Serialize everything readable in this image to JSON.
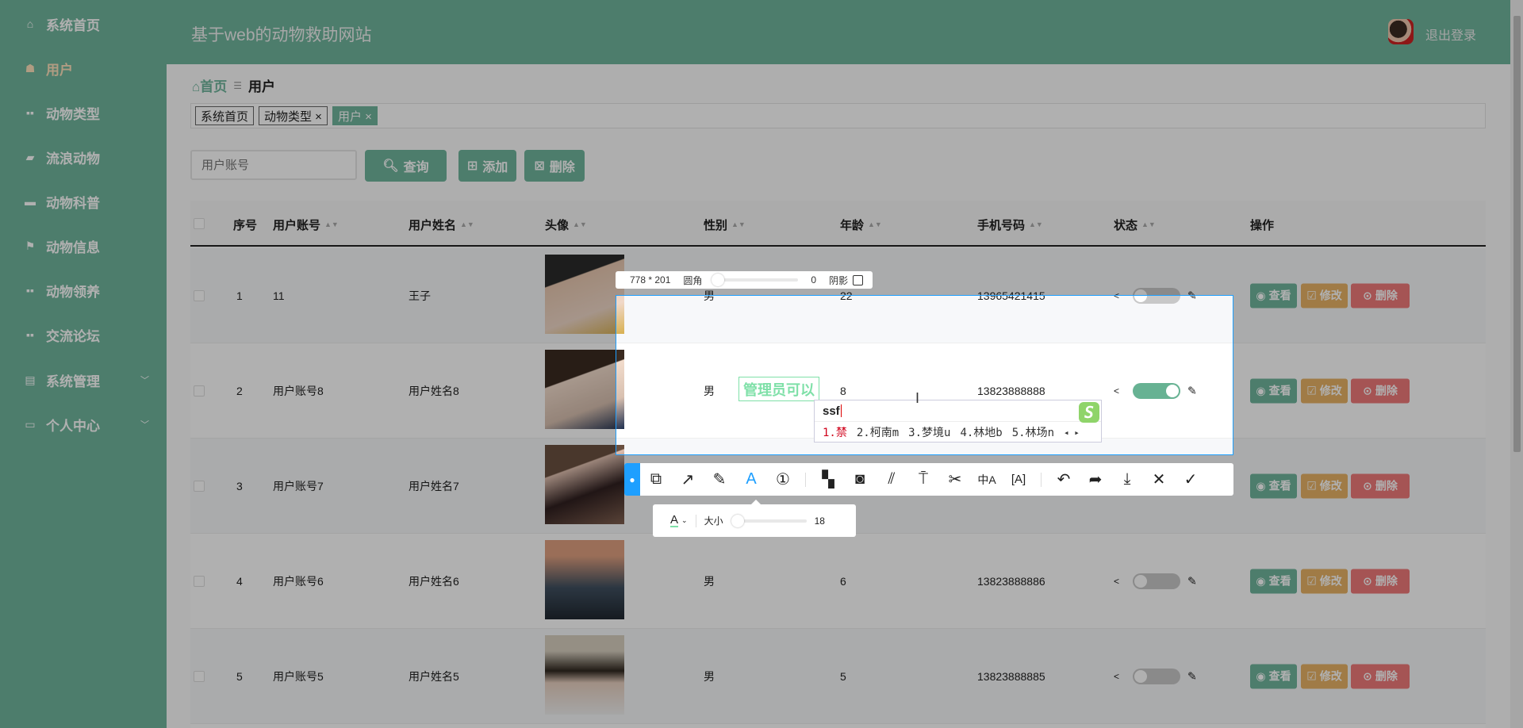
{
  "sidebar": {
    "items": [
      {
        "label": "系统首页",
        "icon": "home-icon"
      },
      {
        "label": "用户",
        "icon": "user-icon",
        "active": true
      },
      {
        "label": "动物类型",
        "icon": "grid-icon"
      },
      {
        "label": "流浪动物",
        "icon": "chat-icon"
      },
      {
        "label": "动物科普",
        "icon": "monitor-icon"
      },
      {
        "label": "动物信息",
        "icon": "flag-icon"
      },
      {
        "label": "动物领养",
        "icon": "grid-icon"
      },
      {
        "label": "交流论坛",
        "icon": "grid-icon"
      },
      {
        "label": "系统管理",
        "icon": "clipboard-icon",
        "chevron": true
      },
      {
        "label": "个人中心",
        "icon": "card-icon",
        "chevron": true
      }
    ]
  },
  "header": {
    "title": "基于web的动物救助网站",
    "logout": "退出登录"
  },
  "breadcrumb": {
    "home": "首页",
    "current": "用户"
  },
  "tabs": [
    {
      "label": "系统首页"
    },
    {
      "label": "动物类型 ×"
    },
    {
      "label": "用户 ×"
    }
  ],
  "search": {
    "placeholder": "用户账号",
    "query_label": "查询",
    "add_label": "添加",
    "delete_label": "删除"
  },
  "table": {
    "headers": [
      "序号",
      "用户账号",
      "用户姓名",
      "头像",
      "性别",
      "年龄",
      "手机号码",
      "状态",
      "操作"
    ],
    "rows": [
      {
        "no": "1",
        "account": "11",
        "name": "王子",
        "gender": "男",
        "age": "22",
        "phone": "13965421415",
        "status": false
      },
      {
        "no": "2",
        "account": "用户账号8",
        "name": "用户姓名8",
        "gender": "男",
        "age": "8",
        "phone": "13823888888",
        "status": true
      },
      {
        "no": "3",
        "account": "用户账号7",
        "name": "用户姓名7",
        "gender": "",
        "age": "",
        "phone": "",
        "status": false
      },
      {
        "no": "4",
        "account": "用户账号6",
        "name": "用户姓名6",
        "gender": "男",
        "age": "6",
        "phone": "13823888886",
        "status": false
      },
      {
        "no": "5",
        "account": "用户账号5",
        "name": "用户姓名5",
        "gender": "男",
        "age": "5",
        "phone": "13823888885",
        "status": false
      }
    ],
    "actions": {
      "view": "查看",
      "edit": "修改",
      "delete": "删除"
    }
  },
  "screenshot_tool": {
    "size": "778 * 201",
    "radius_label": "圆角",
    "radius_value": "0",
    "shadow_label": "阴影",
    "text_size_label": "大小",
    "text_size_value": "18",
    "annotation_text": "管理员可以",
    "ime_input": "ssf",
    "ime_candidates": [
      "1.禁",
      "2.柯南m",
      "3.梦境u",
      "4.林地b",
      "5.林场n"
    ]
  },
  "colors": {
    "accent": "#70b59d",
    "edit": "#e8b366",
    "danger": "#f07a7a",
    "selection": "#1e9fff"
  }
}
